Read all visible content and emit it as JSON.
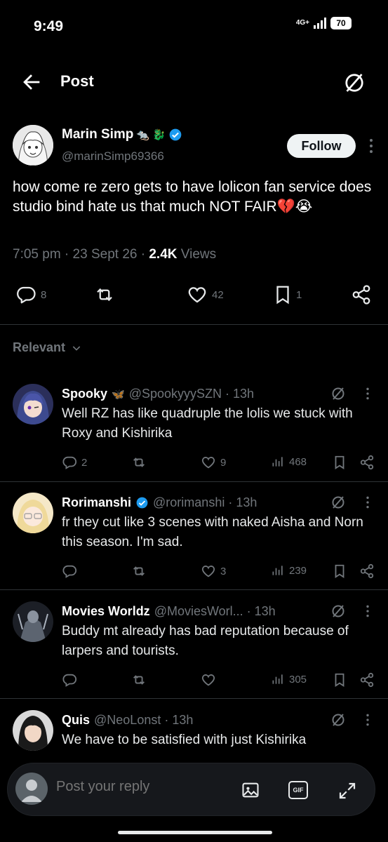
{
  "status_bar": {
    "time": "9:49",
    "network": "4G+",
    "battery": "70"
  },
  "header": {
    "title": "Post"
  },
  "post": {
    "author_name": "Marin Simp",
    "author_emoji": "🐀 🐉",
    "handle": "@marinSimp69366",
    "follow_label": "Follow",
    "text": "how come re zero gets to have lolicon fan service does studio bind hate us that much NOT FAIR💔😭",
    "time": "7:05 pm",
    "date": "23 Sept 26",
    "views_count": "2.4K",
    "views_label": "Views",
    "replies": "8",
    "likes": "42",
    "bookmarks": "1"
  },
  "sort": {
    "label": "Relevant"
  },
  "replies": [
    {
      "name": "Spooky",
      "emoji": "🦋",
      "handle": "@SpookyyySZN · 13h",
      "text": "Well RZ has like quadruple the lolis we stuck with Roxy and Kishirika",
      "replies": "2",
      "likes": "9",
      "views": "468"
    },
    {
      "name": "Rorimanshi",
      "emoji": "",
      "handle": "@rorimanshi · 13h",
      "text": "fr they cut like 3 scenes with naked Aisha and Norn this season. I'm sad.",
      "replies": "",
      "likes": "3",
      "views": "239"
    },
    {
      "name": "Movies Worldz",
      "emoji": "",
      "handle": "@MoviesWorl... · 13h",
      "text": "Buddy mt already has bad reputation because of larpers and tourists.",
      "replies": "",
      "likes": "",
      "views": "305"
    },
    {
      "name": "Quis",
      "emoji": "",
      "handle": "@NeoLonst · 13h",
      "text": "We have to be satisfied with just Kishirika",
      "replies": "",
      "likes": "",
      "views": ""
    }
  ],
  "composer": {
    "placeholder": "Post your reply",
    "gif_label": "GIF"
  }
}
